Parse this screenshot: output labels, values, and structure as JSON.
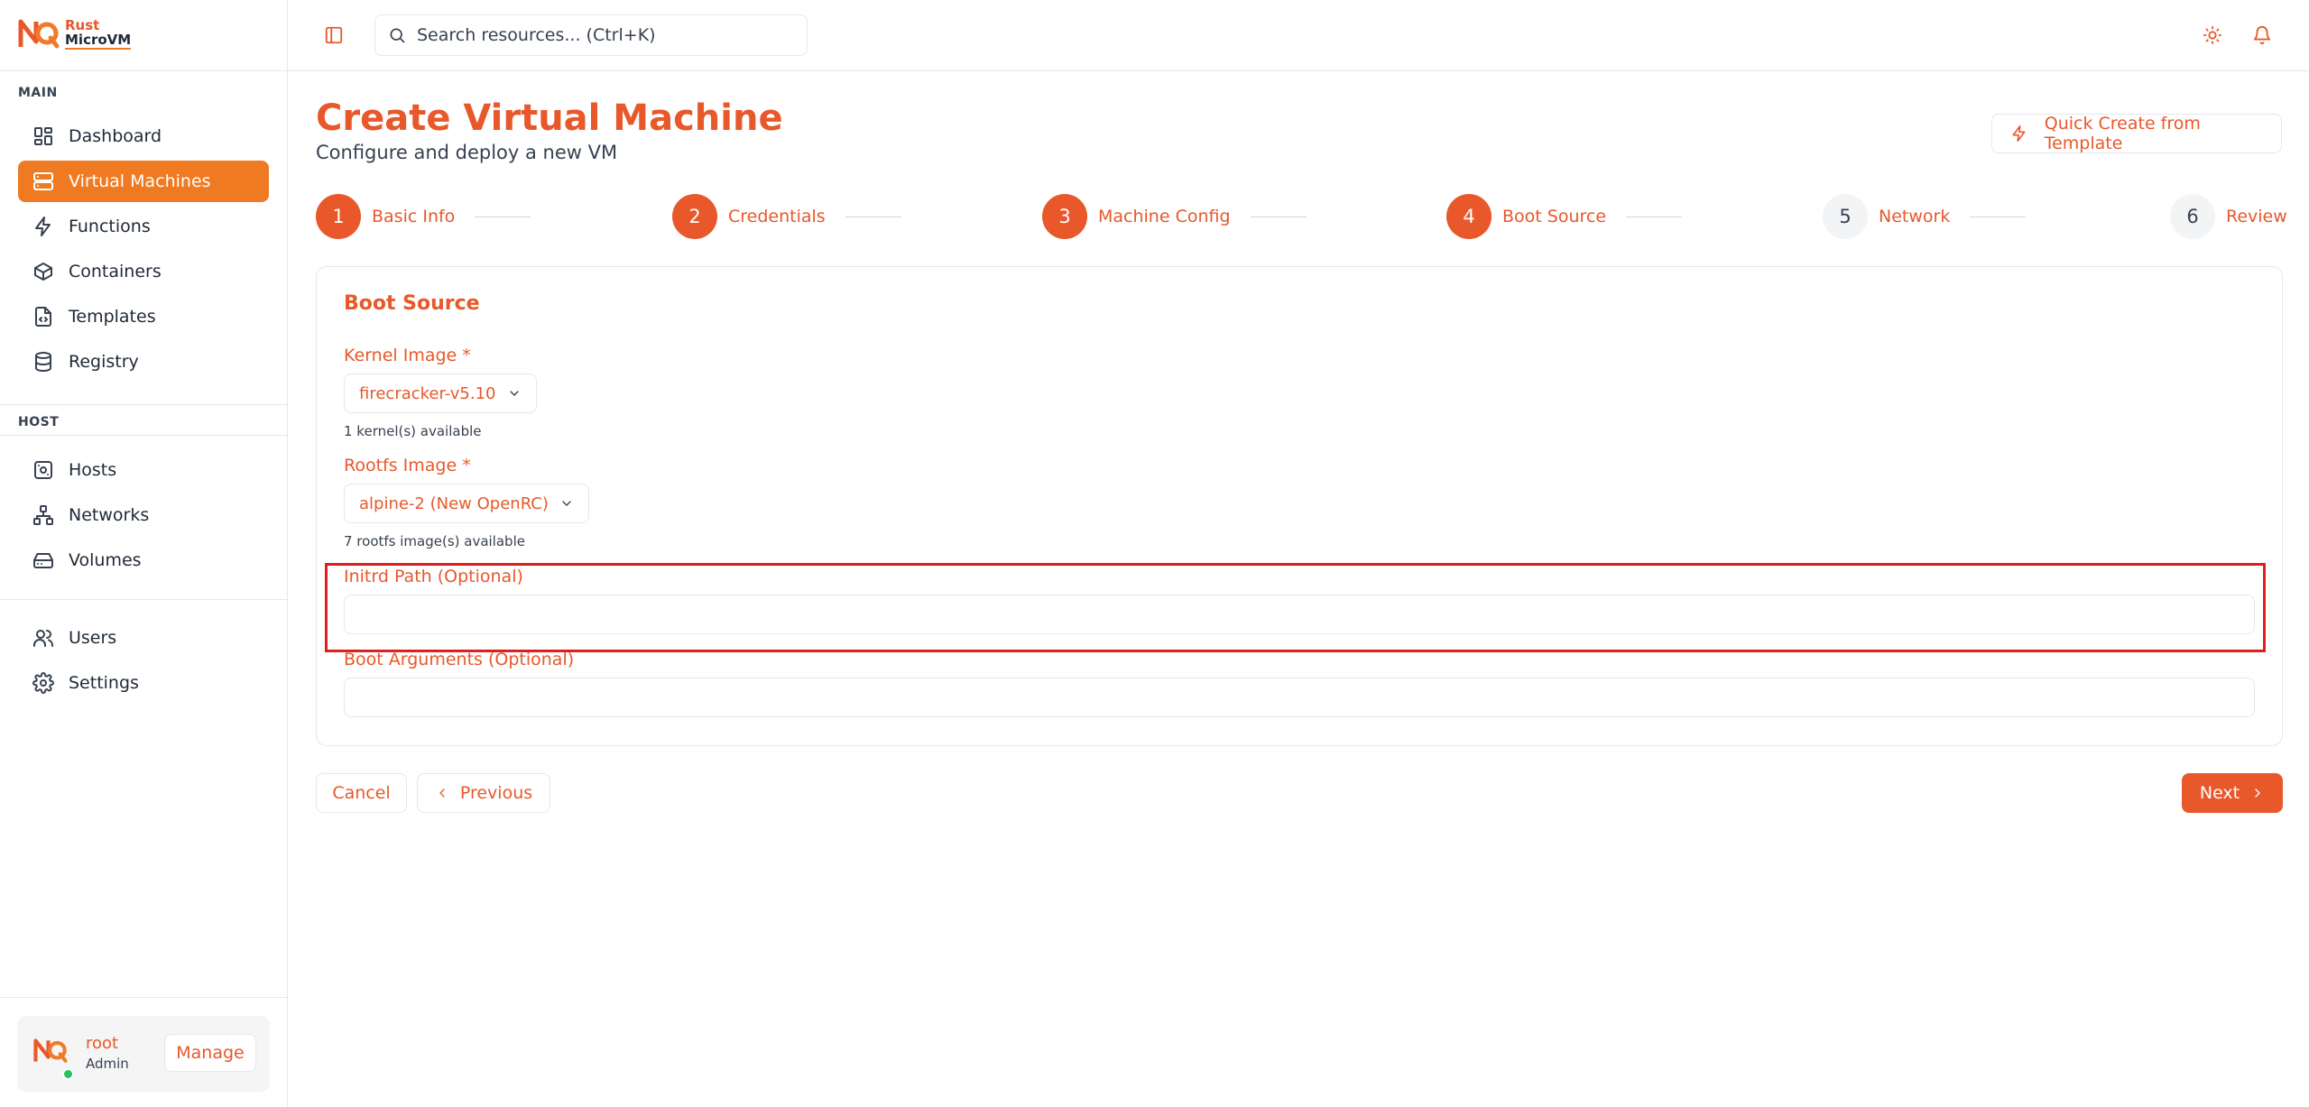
{
  "brand": {
    "line1": "Rust",
    "line2": "MicroVM"
  },
  "sidebar": {
    "sections": [
      {
        "label": "MAIN"
      },
      {
        "label": "HOST"
      }
    ],
    "main_items": [
      {
        "label": "Dashboard",
        "icon": "dashboard-icon"
      },
      {
        "label": "Virtual Machines",
        "icon": "server-icon",
        "active": true
      },
      {
        "label": "Functions",
        "icon": "lightning-icon"
      },
      {
        "label": "Containers",
        "icon": "box-icon"
      },
      {
        "label": "Templates",
        "icon": "file-code-icon"
      },
      {
        "label": "Registry",
        "icon": "database-icon"
      }
    ],
    "host_items": [
      {
        "label": "Hosts",
        "icon": "host-icon"
      },
      {
        "label": "Networks",
        "icon": "network-icon"
      },
      {
        "label": "Volumes",
        "icon": "drive-icon"
      }
    ],
    "other_items": [
      {
        "label": "Users",
        "icon": "users-icon"
      },
      {
        "label": "Settings",
        "icon": "gear-icon"
      }
    ],
    "user": {
      "name": "root",
      "role": "Admin",
      "manage_label": "Manage"
    }
  },
  "topbar": {
    "search_placeholder": "Search resources... (Ctrl+K)"
  },
  "page": {
    "title": "Create Virtual Machine",
    "subtitle": "Configure and deploy a new VM",
    "quick_create_label": "Quick Create from Template"
  },
  "steps": [
    {
      "num": "1",
      "label": "Basic Info",
      "state": "done"
    },
    {
      "num": "2",
      "label": "Credentials",
      "state": "done"
    },
    {
      "num": "3",
      "label": "Machine Config",
      "state": "done"
    },
    {
      "num": "4",
      "label": "Boot Source",
      "state": "current"
    },
    {
      "num": "5",
      "label": "Network",
      "state": "todo"
    },
    {
      "num": "6",
      "label": "Review",
      "state": "todo"
    }
  ],
  "form": {
    "section_title": "Boot Source",
    "kernel": {
      "label": "Kernel Image",
      "required": "*",
      "value": "firecracker-v5.10",
      "hint": "1 kernel(s) available"
    },
    "rootfs": {
      "label": "Rootfs Image",
      "required": "*",
      "value": "alpine-2 (New OpenRC)",
      "hint": "7 rootfs image(s) available"
    },
    "initrd": {
      "label": "Initrd Path (Optional)",
      "value": ""
    },
    "boot_args": {
      "label": "Boot Arguments (Optional)",
      "value": ""
    }
  },
  "actions": {
    "cancel": "Cancel",
    "previous": "Previous",
    "next": "Next"
  },
  "colors": {
    "accent": "#e8582a",
    "active_nav": "#f07a22",
    "highlight": "#e01e1e",
    "status_online": "#22c55e"
  }
}
